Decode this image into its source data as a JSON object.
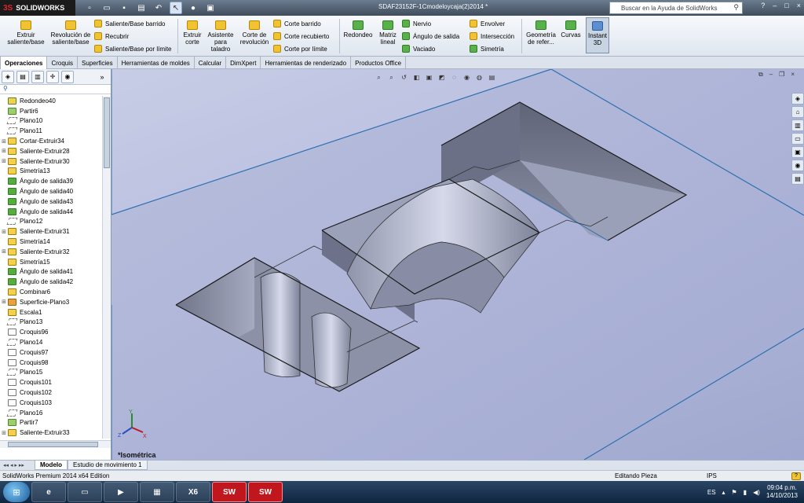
{
  "title_bar": {
    "app_name": "SOLIDWORKS",
    "document_title": "SDAF23152F-1Cmodeloycaja(2)2014 *",
    "search_placeholder": "Buscar en la Ayuda de SolidWorks",
    "help_icon": "?",
    "window_controls": [
      "–",
      "□",
      "×"
    ]
  },
  "ribbon": {
    "large_buttons": [
      {
        "id": "extruir-saliente",
        "label": "Extruir saliente/base",
        "icon": "extrude-boss-icon",
        "color": "#f1c232"
      },
      {
        "id": "revolucion-saliente",
        "label": "Revolución de saliente/base",
        "icon": "revolve-boss-icon",
        "color": "#f1c232"
      },
      {
        "id": "extruir-corte",
        "label": "Extruir corte",
        "icon": "extrude-cut-icon",
        "color": "#f1c232"
      },
      {
        "id": "asistente-taladro",
        "label": "Asistente para taladro",
        "icon": "hole-wizard-icon",
        "color": "#f1c232"
      },
      {
        "id": "corte-revolucion",
        "label": "Corte de revolución",
        "icon": "revolve-cut-icon",
        "color": "#f1c232"
      },
      {
        "id": "redondeo",
        "label": "Redondeo",
        "icon": "fillet-icon",
        "color": "#58b14a"
      },
      {
        "id": "matriz-lineal",
        "label": "Matriz lineal",
        "icon": "linear-pattern-icon",
        "color": "#58b14a"
      },
      {
        "id": "geometria-referencia",
        "label": "Geometría de refer...",
        "icon": "reference-geometry-icon",
        "color": "#58b14a"
      },
      {
        "id": "curvas",
        "label": "Curvas",
        "icon": "curves-icon",
        "color": "#58b14a"
      }
    ],
    "small_buttons": [
      {
        "id": "saliente-barrido",
        "label": "Saliente/Base barrido",
        "icon": "sweep-icon"
      },
      {
        "id": "recubrir",
        "label": "Recubrir",
        "icon": "loft-icon"
      },
      {
        "id": "saliente-limite",
        "label": "Saliente/Base por límite",
        "icon": "boundary-boss-icon"
      },
      {
        "id": "corte-barrido",
        "label": "Corte barrido",
        "icon": "swept-cut-icon"
      },
      {
        "id": "corte-recubierto",
        "label": "Corte recubierto",
        "icon": "lofted-cut-icon"
      },
      {
        "id": "corte-limite",
        "label": "Corte por límite",
        "icon": "boundary-cut-icon"
      },
      {
        "id": "nervio",
        "label": "Nervio",
        "icon": "rib-icon"
      },
      {
        "id": "angulo-salida",
        "label": "Ángulo de salida",
        "icon": "draft-icon"
      },
      {
        "id": "vaciado",
        "label": "Vaciado",
        "icon": "shell-icon"
      },
      {
        "id": "envolver",
        "label": "Envolver",
        "icon": "wrap-icon"
      },
      {
        "id": "interseccion",
        "label": "Intersección",
        "icon": "intersect-icon"
      },
      {
        "id": "simetria",
        "label": "Simetría",
        "icon": "mirror-icon"
      }
    ],
    "instant3d_label": "Instant 3D"
  },
  "tabs": [
    "Operaciones",
    "Croquis",
    "Superficies",
    "Herramientas de moldes",
    "Calcular",
    "DimXpert",
    "Herramientas de renderizado",
    "Productos Office"
  ],
  "feature_tree": {
    "items": [
      {
        "label": "Redondeo40",
        "type": "fillet",
        "expandable": false
      },
      {
        "label": "Partir6",
        "type": "split",
        "expandable": false
      },
      {
        "label": "Plano10",
        "type": "plane",
        "expandable": false
      },
      {
        "label": "Plano11",
        "type": "plane",
        "expandable": false
      },
      {
        "label": "Cortar-Extruir34",
        "type": "feat",
        "expandable": true
      },
      {
        "label": "Saliente-Extruir28",
        "type": "feat",
        "expandable": true
      },
      {
        "label": "Saliente-Extruir30",
        "type": "feat",
        "expandable": true
      },
      {
        "label": "Simetría13",
        "type": "feat",
        "expandable": false
      },
      {
        "label": "Ángulo de salida39",
        "type": "draft",
        "expandable": false
      },
      {
        "label": "Ángulo de salida40",
        "type": "draft",
        "expandable": false
      },
      {
        "label": "Ángulo de salida43",
        "type": "draft",
        "expandable": false
      },
      {
        "label": "Ángulo de salida44",
        "type": "draft",
        "expandable": false
      },
      {
        "label": "Plano12",
        "type": "plane",
        "expandable": false
      },
      {
        "label": "Saliente-Extruir31",
        "type": "feat",
        "expandable": true
      },
      {
        "label": "Simetría14",
        "type": "feat",
        "expandable": false
      },
      {
        "label": "Saliente-Extruir32",
        "type": "feat",
        "expandable": true
      },
      {
        "label": "Simetría15",
        "type": "feat",
        "expandable": false
      },
      {
        "label": "Ángulo de salida41",
        "type": "draft",
        "expandable": false
      },
      {
        "label": "Ángulo de salida42",
        "type": "draft",
        "expandable": false
      },
      {
        "label": "Combinar6",
        "type": "feat",
        "expandable": false
      },
      {
        "label": "Superficie-Plano3",
        "type": "surf",
        "expandable": true
      },
      {
        "label": "Escala1",
        "type": "feat",
        "expandable": false
      },
      {
        "label": "Plano13",
        "type": "plane",
        "expandable": false
      },
      {
        "label": "Croquis96",
        "type": "sketch",
        "expandable": false
      },
      {
        "label": "Plano14",
        "type": "plane",
        "expandable": false
      },
      {
        "label": "Croquis97",
        "type": "sketch",
        "expandable": false
      },
      {
        "label": "Croquis98",
        "type": "sketch",
        "expandable": false
      },
      {
        "label": "Plano15",
        "type": "plane",
        "expandable": false
      },
      {
        "label": "Croquis101",
        "type": "sketch",
        "expandable": false
      },
      {
        "label": "Croquis102",
        "type": "sketch",
        "expandable": false
      },
      {
        "label": "Croquis103",
        "type": "sketch",
        "expandable": false
      },
      {
        "label": "Plano16",
        "type": "plane",
        "expandable": false
      },
      {
        "label": "Partir7",
        "type": "split",
        "expandable": false
      },
      {
        "label": "Saliente-Extruir33",
        "type": "feat",
        "expandable": true
      }
    ]
  },
  "viewport": {
    "view_name": "*Isométrica",
    "triad_labels": [
      "Y",
      "X",
      "Z"
    ]
  },
  "bottom_tabs": [
    "Modelo",
    "Estudio de movimiento 1"
  ],
  "status_bar": {
    "edition": "SolidWorks Premium 2014 x64 Edition",
    "mode": "Editando Pieza",
    "units": "IPS"
  },
  "taskbar": {
    "language": "ES",
    "time": "09:04 p.m.",
    "date": "14/10/2013"
  }
}
